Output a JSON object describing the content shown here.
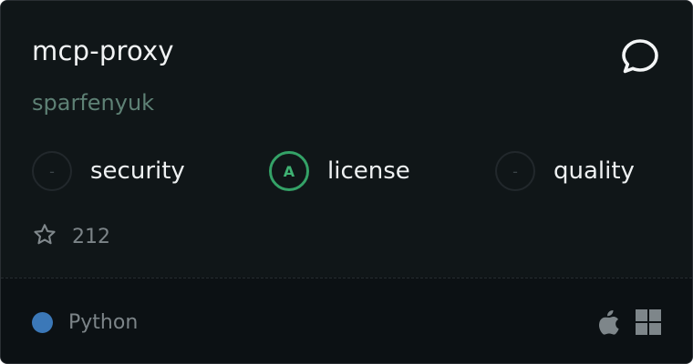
{
  "server": {
    "name": "mcp-proxy",
    "author": "sparfenyuk"
  },
  "scores": [
    {
      "label": "security",
      "grade": "-",
      "state": "unrated"
    },
    {
      "label": "license",
      "grade": "A",
      "state": "rated"
    },
    {
      "label": "quality",
      "grade": "-",
      "state": "unrated"
    }
  ],
  "stars": {
    "count": "212",
    "icon": "star-icon"
  },
  "language": {
    "name": "Python",
    "color": "#3b78b8"
  },
  "platforms": [
    "apple-icon",
    "windows-icon"
  ],
  "colors": {
    "background": "#101618",
    "footer": "#0c1114",
    "license_accent": "#34a267",
    "author": "#5e8175"
  }
}
